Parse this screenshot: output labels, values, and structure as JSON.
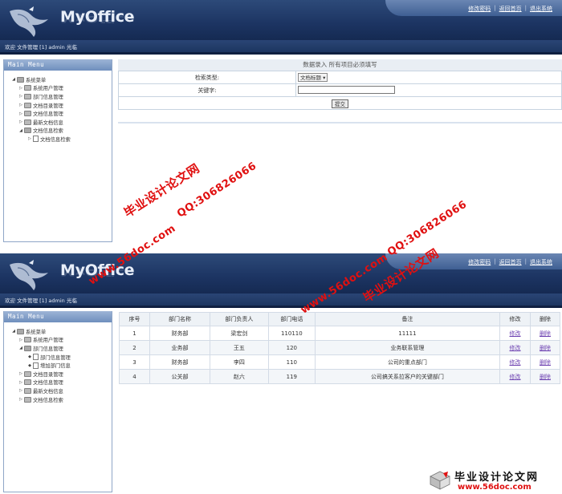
{
  "app": {
    "brand": "MyOffice"
  },
  "header": {
    "links": [
      "修改密码",
      "返回首页",
      "退出系统"
    ],
    "welcome": "欢迎 文件管理 [1] admin 光临"
  },
  "sidebar": {
    "title": "Main Menu",
    "root": "系统菜单",
    "shot1_items": [
      {
        "label": "系统用户管理"
      },
      {
        "label": "部门信息管理"
      },
      {
        "label": "文档目录管理"
      },
      {
        "label": "文档信息管理"
      },
      {
        "label": "最新文档信息"
      },
      {
        "label": "文档信息检索"
      }
    ],
    "shot1_child": "文档信息检索",
    "shot2_items": [
      {
        "label": "系统用户管理"
      },
      {
        "label": "部门信息管理"
      },
      {
        "label": "文档目录管理"
      },
      {
        "label": "文档信息管理"
      },
      {
        "label": "最新文档信息"
      },
      {
        "label": "文档信息检索"
      }
    ],
    "shot2_children": [
      "部门信息管理",
      "增加部门信息"
    ]
  },
  "search_form": {
    "title": "数据录入  所有项目必须填写",
    "type_label": "检索类型:",
    "type_value": "文档标题",
    "keyword_label": "关键字:",
    "keyword_value": "",
    "submit": "提交"
  },
  "dept_table": {
    "headers": [
      "序号",
      "部门名称",
      "部门负责人",
      "部门电话",
      "备注",
      "修改",
      "删除"
    ],
    "rows": [
      {
        "no": "1",
        "name": "财务部",
        "leader": "梁宏剑",
        "phone": "110110",
        "note": "11111",
        "edit": "修改",
        "del": "删除"
      },
      {
        "no": "2",
        "name": "业务部",
        "leader": "王五",
        "phone": "120",
        "note": "业务联系管理",
        "edit": "修改",
        "del": "删除"
      },
      {
        "no": "3",
        "name": "财务部",
        "leader": "李四",
        "phone": "110",
        "note": "公司的重点部门",
        "edit": "修改",
        "del": "删除"
      },
      {
        "no": "4",
        "name": "公关部",
        "leader": "赵六",
        "phone": "119",
        "note": "公司搞关系拉客户的关键部门",
        "edit": "修改",
        "del": "删除"
      }
    ]
  },
  "watermarks": {
    "site_cn": "毕业设计论文网",
    "site_url": "www.56doc.com",
    "qq": "QQ:306826066",
    "footer_cn": "毕业设计论文网",
    "footer_url": "www.56doc.com"
  },
  "colors": {
    "header_navy": "#1c3462",
    "link_purple": "#6b3fb0",
    "watermark_red": "#e01010"
  }
}
